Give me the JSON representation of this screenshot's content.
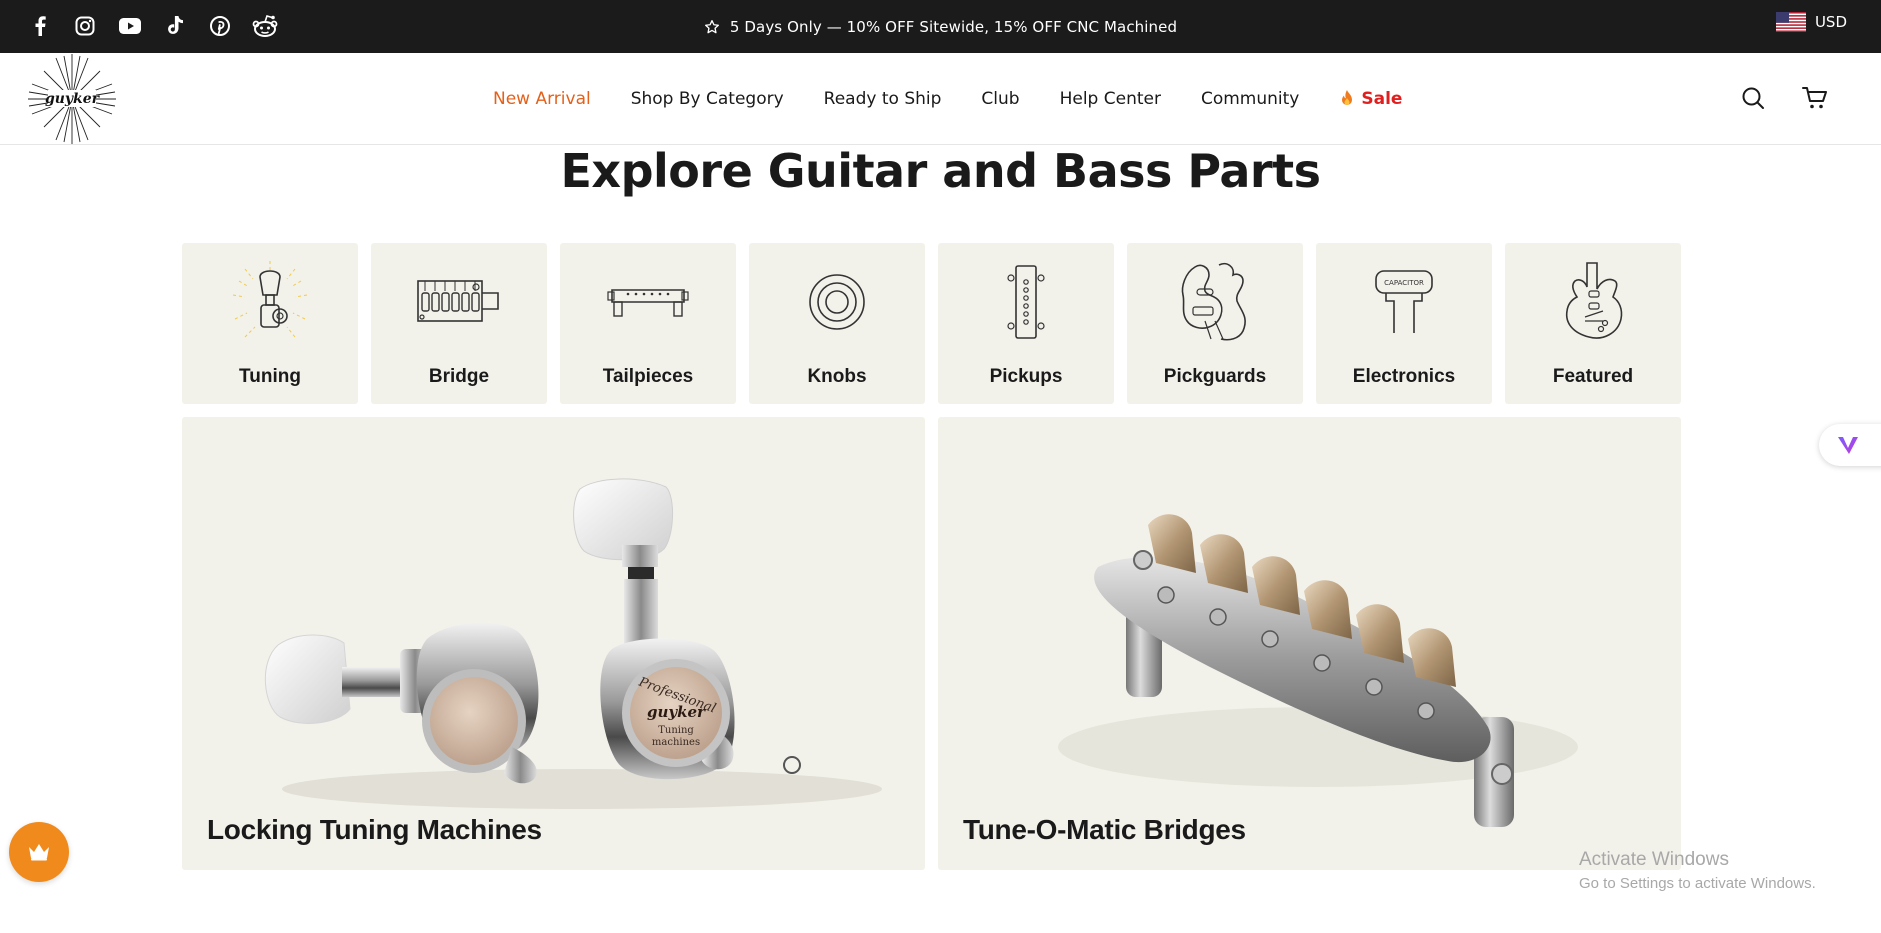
{
  "announcement": {
    "text": "5 Days Only — 10% OFF Sitewide, 15% OFF CNC Machined"
  },
  "social_icons": [
    "facebook-icon",
    "instagram-icon",
    "youtube-icon",
    "tiktok-icon",
    "pinterest-icon",
    "reddit-icon"
  ],
  "currency": {
    "code": "USD",
    "flag": "us-flag-icon"
  },
  "logo": {
    "text": "guyker"
  },
  "nav": {
    "items": [
      {
        "label": "New Arrival"
      },
      {
        "label": "Shop By Category"
      },
      {
        "label": "Ready to Ship"
      },
      {
        "label": "Club"
      },
      {
        "label": "Help Center"
      },
      {
        "label": "Community"
      },
      {
        "label": "Sale"
      }
    ]
  },
  "header_icons": [
    "search-icon",
    "cart-icon"
  ],
  "section": {
    "title": "Explore Guitar and Bass Parts"
  },
  "categories": [
    {
      "label": "Tuning",
      "icon": "tuning-peg-icon"
    },
    {
      "label": "Bridge",
      "icon": "bridge-icon"
    },
    {
      "label": "Tailpieces",
      "icon": "tailpiece-icon"
    },
    {
      "label": "Knobs",
      "icon": "knob-icon"
    },
    {
      "label": "Pickups",
      "icon": "pickup-icon"
    },
    {
      "label": "Pickguards",
      "icon": "pickguard-icon"
    },
    {
      "label": "Electronics",
      "icon": "capacitor-icon"
    },
    {
      "label": "Featured",
      "icon": "guitar-body-icon"
    }
  ],
  "capacitor_label": "CAPACITOR",
  "cards": [
    {
      "title": "Locking Tuning Machines",
      "badge_lines": [
        "Professional",
        "guyker",
        "Tuning",
        "machines"
      ]
    },
    {
      "title": "Tune-O-Matic Bridges"
    }
  ],
  "watermark": {
    "line1": "Activate Windows",
    "line2": "Go to Settings to activate Windows."
  },
  "colors": {
    "topbar": "#1b1b1b",
    "accent_new": "#e4611b",
    "sale": "#e02020",
    "tile_bg": "#f3f2ea",
    "reward_button": "#f08a1c"
  }
}
